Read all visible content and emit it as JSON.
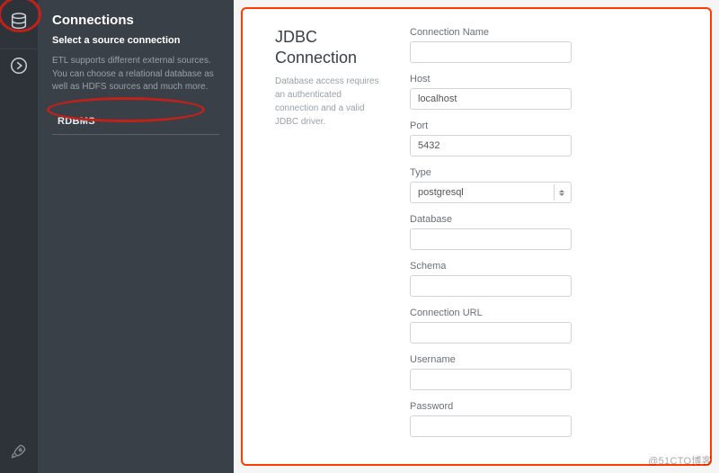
{
  "rail": {
    "icons": [
      "database-icon",
      "continue-icon",
      "rocket-icon"
    ]
  },
  "sidebar": {
    "title": "Connections",
    "subtitle": "Select a source connection",
    "description": "ETL supports different external sources. You can choose a relational database as well as HDFS sources and much more.",
    "item_rdbms": "RDBMS"
  },
  "panel": {
    "title": "JDBC Connection",
    "description": "Database access requires an authenticated connection and a valid JDBC driver."
  },
  "form": {
    "connection_name": {
      "label": "Connection Name",
      "value": ""
    },
    "host": {
      "label": "Host",
      "value": "localhost"
    },
    "port": {
      "label": "Port",
      "value": "5432"
    },
    "type": {
      "label": "Type",
      "value": "postgresql"
    },
    "database": {
      "label": "Database",
      "value": ""
    },
    "schema": {
      "label": "Schema",
      "value": ""
    },
    "connection_url": {
      "label": "Connection URL",
      "value": ""
    },
    "username": {
      "label": "Username",
      "value": ""
    },
    "password": {
      "label": "Password",
      "value": ""
    }
  },
  "watermark": "@51CTO博客"
}
